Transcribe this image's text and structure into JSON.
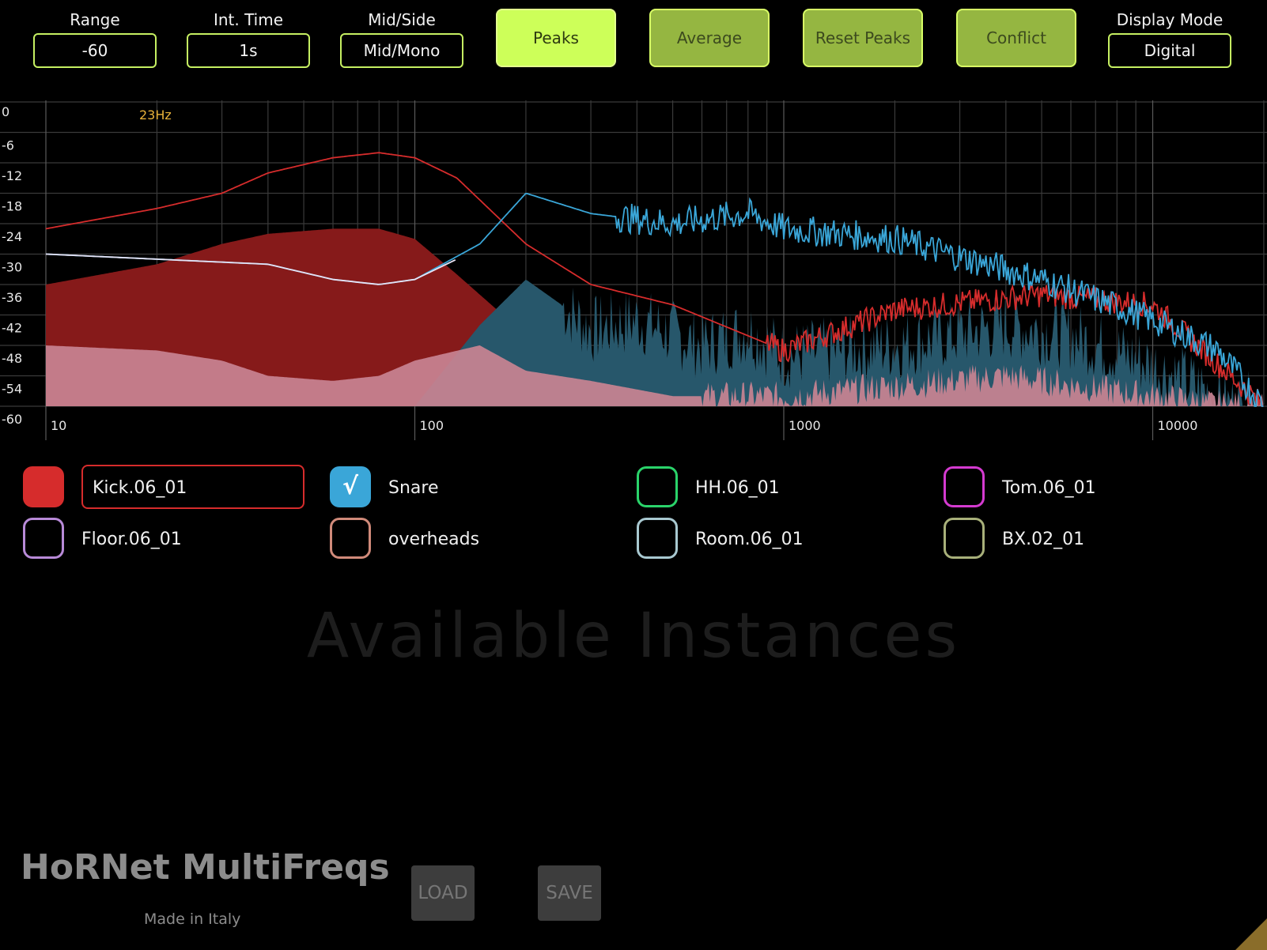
{
  "controls": {
    "range": {
      "label": "Range",
      "value": "-60"
    },
    "int_time": {
      "label": "Int. Time",
      "value": "1s"
    },
    "mid_side": {
      "label": "Mid/Side",
      "value": "Mid/Mono"
    },
    "display_mode": {
      "label": "Display Mode",
      "value": "Digital"
    }
  },
  "buttons": {
    "peaks": "Peaks",
    "average": "Average",
    "reset_peaks": "Reset Peaks",
    "conflict": "Conflict"
  },
  "spectrum": {
    "marker_label": "23Hz",
    "y_ticks": [
      "0",
      "-6",
      "-12",
      "-18",
      "-24",
      "-30",
      "-36",
      "-42",
      "-48",
      "-54",
      "-60"
    ],
    "x_ticks": [
      "10",
      "100",
      "1000",
      "10000"
    ],
    "colors": {
      "kick": "#d62c2c",
      "kick_fill": "#861a1a",
      "snare": "#3aa6d8",
      "snare_fill": "#27576b",
      "pink_fill": "#c98393",
      "marker": "#e8b23a"
    }
  },
  "chart_data": {
    "type": "area",
    "x_scale": "log",
    "xlim": [
      10,
      20000
    ],
    "ylim": [
      -60,
      0
    ],
    "series": [
      {
        "name": "Kick.06_01",
        "color": "#d62c2c",
        "x": [
          10,
          20,
          30,
          40,
          60,
          80,
          100,
          130,
          200,
          300,
          500,
          1000,
          2000,
          5000,
          10000,
          20000
        ],
        "values": [
          -25,
          -21,
          -18,
          -14,
          -11,
          -10,
          -11,
          -15,
          -28,
          -36,
          -40,
          -49,
          -41,
          -38,
          -40,
          -60
        ]
      },
      {
        "name": "Snare",
        "color": "#3aa6d8",
        "x": [
          10,
          20,
          40,
          60,
          80,
          100,
          150,
          200,
          300,
          500,
          800,
          1000,
          2000,
          5000,
          10000,
          15000,
          20000
        ],
        "values": [
          -30,
          -31,
          -32,
          -35,
          -36,
          -35,
          -28,
          -18,
          -22,
          -24,
          -22,
          -25,
          -27,
          -35,
          -43,
          -49,
          -60
        ]
      }
    ]
  },
  "instances": [
    {
      "name": "Kick.06_01",
      "color": "#d62c2c",
      "checked": false,
      "filled": true,
      "selected": true
    },
    {
      "name": "Snare",
      "color": "#3aa6d8",
      "checked": true,
      "filled": true,
      "selected": false
    },
    {
      "name": "HH.06_01",
      "color": "#2ad36a",
      "checked": false,
      "filled": false,
      "selected": false
    },
    {
      "name": "Tom.06_01",
      "color": "#d43ad0",
      "checked": false,
      "filled": false,
      "selected": false
    },
    {
      "name": "Floor.06_01",
      "color": "#b88ad8",
      "checked": false,
      "filled": false,
      "selected": false
    },
    {
      "name": "overheads",
      "color": "#d08a7a",
      "checked": false,
      "filled": false,
      "selected": false
    },
    {
      "name": "Room.06_01",
      "color": "#a8c8d0",
      "checked": false,
      "filled": false,
      "selected": false
    },
    {
      "name": "BX.02_01",
      "color": "#a8b07a",
      "checked": false,
      "filled": false,
      "selected": false
    }
  ],
  "check_glyph": "√",
  "watermark": "Available Instances",
  "footer": {
    "brand": "HoRNet MultiFreqs",
    "made_in": "Made in Italy",
    "load": "LOAD",
    "save": "SAVE"
  }
}
